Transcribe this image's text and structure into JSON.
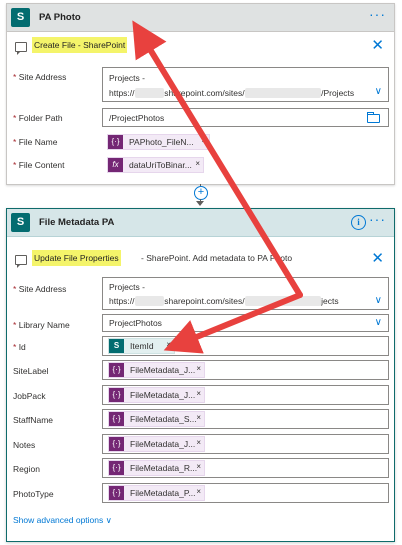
{
  "card1": {
    "title": "PA Photo",
    "more": "···",
    "action_highlight": "Create File - SharePoint",
    "close": "✕",
    "fields": [
      {
        "label": "Site Address",
        "required": "*",
        "line1": "Projects -",
        "line2_prefix": "https://",
        "line2_mid": "sharepoint.com/sites/",
        "line2_suffix": "/Projects"
      },
      {
        "label": "Folder Path",
        "required": "*",
        "value": "/ProjectPhotos"
      },
      {
        "label": "File Name",
        "required": "*",
        "token": "PAPhoto_FileN...",
        "token_icon": "{·}"
      },
      {
        "label": "File Content",
        "required": "*",
        "token": "dataUriToBinar...",
        "token_icon": "fx"
      }
    ]
  },
  "card2": {
    "title": "File Metadata PA",
    "more": "···",
    "info": "i",
    "action_highlight": "Update File Properties",
    "action_rest": " - SharePoint. Add metadata to PA Photo",
    "close": "✕",
    "site_address": {
      "label": "Site Address",
      "required": "*",
      "line1": "Projects -",
      "line2_prefix": "https://",
      "line2_mid": "sharepoint.com/sites/",
      "line2_suffix": "jects"
    },
    "library": {
      "label": "Library Name",
      "required": "*",
      "value": "ProjectPhotos"
    },
    "id": {
      "label": "Id",
      "required": "*",
      "token": "ItemId"
    },
    "meta_fields": [
      {
        "label": "SiteLabel",
        "token": "FileMetadata_J..."
      },
      {
        "label": "JobPack",
        "token": "FileMetadata_J..."
      },
      {
        "label": "StaffName",
        "token": "FileMetadata_S..."
      },
      {
        "label": "Notes",
        "token": "FileMetadata_J..."
      },
      {
        "label": "Region",
        "token": "FileMetadata_R..."
      },
      {
        "label": "PhotoType",
        "token": "FileMetadata_P..."
      }
    ],
    "show_advanced": "Show advanced options",
    "token_icon": "{·}",
    "token_close": "×"
  },
  "icons": {
    "sharepoint": "sharepoint-icon",
    "chevron": "chevron-down-icon",
    "folder": "folder-icon",
    "comment": "comment-icon"
  },
  "colors": {
    "accent": "#0078d4",
    "sharepoint": "#036c70",
    "token_purple": "#742774",
    "highlight": "#f4f46a",
    "arrow_red": "#e8413e"
  }
}
